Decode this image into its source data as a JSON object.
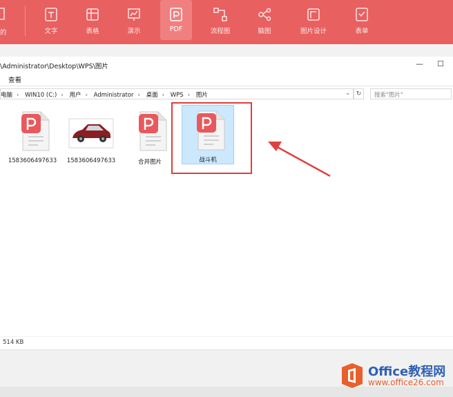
{
  "toolbar": {
    "left_partial_label": "的",
    "items": [
      {
        "label": "文字"
      },
      {
        "label": "表格"
      },
      {
        "label": "演示"
      },
      {
        "label": "PDF"
      },
      {
        "label": "流程图"
      },
      {
        "label": "脑图"
      },
      {
        "label": "图片设计"
      },
      {
        "label": "表单"
      }
    ],
    "accent": "#e86060"
  },
  "window": {
    "title_path": "\\Administrator\\Desktop\\WPS\\图片",
    "minimize": "—",
    "maximize": "☐"
  },
  "ribbon": {
    "view": "查看"
  },
  "address": {
    "crumbs": [
      "电脑",
      "WIN10 (C:)",
      "用户",
      "Administrator",
      "桌面",
      "WPS",
      "图片"
    ],
    "separator": "›",
    "dropdown": "⌄",
    "refresh": "↻"
  },
  "search": {
    "placeholder": "搜索\"图片\""
  },
  "files": [
    {
      "name": "1583606497633",
      "type": "pdf"
    },
    {
      "name": "1583606497633",
      "type": "image"
    },
    {
      "name": "合并图片",
      "type": "pdf"
    },
    {
      "name": "战斗机",
      "type": "pdf",
      "selected": true
    }
  ],
  "status": {
    "size": "514 KB"
  },
  "watermark": {
    "line1": "Office教程网",
    "line2": "www.office26.com",
    "colors": {
      "blue": "#2e5fb4",
      "orange": "#e8602c"
    }
  }
}
